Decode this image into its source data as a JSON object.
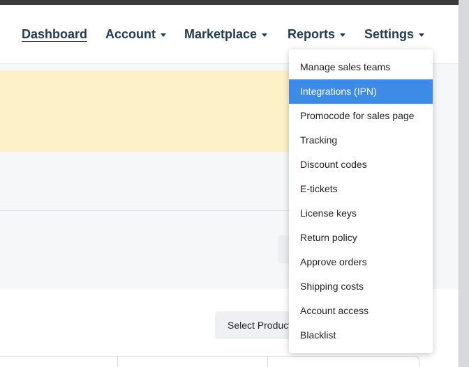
{
  "nav": {
    "items": [
      {
        "label": "Dashboard",
        "name": "nav-dashboard",
        "active": true,
        "caret": false
      },
      {
        "label": "Account",
        "name": "nav-account",
        "active": false,
        "caret": true
      },
      {
        "label": "Marketplace",
        "name": "nav-marketplace",
        "active": false,
        "caret": true
      },
      {
        "label": "Reports",
        "name": "nav-reports",
        "active": false,
        "caret": true
      },
      {
        "label": "Settings",
        "name": "nav-settings",
        "active": false,
        "caret": true
      }
    ]
  },
  "settings_menu": {
    "highlighted_index": 1,
    "highlight_color": "#3d8be6",
    "items": [
      "Manage sales teams",
      "Integrations (IPN)",
      "Promocode for sales page",
      "Tracking",
      "Discount codes",
      "E-tickets",
      "License keys",
      "Return policy",
      "Approve orders",
      "Shipping costs",
      "Account access",
      "Blacklist"
    ]
  },
  "content": {
    "select_product_label": "Select Product",
    "alert_color": "#fdf1c8"
  }
}
